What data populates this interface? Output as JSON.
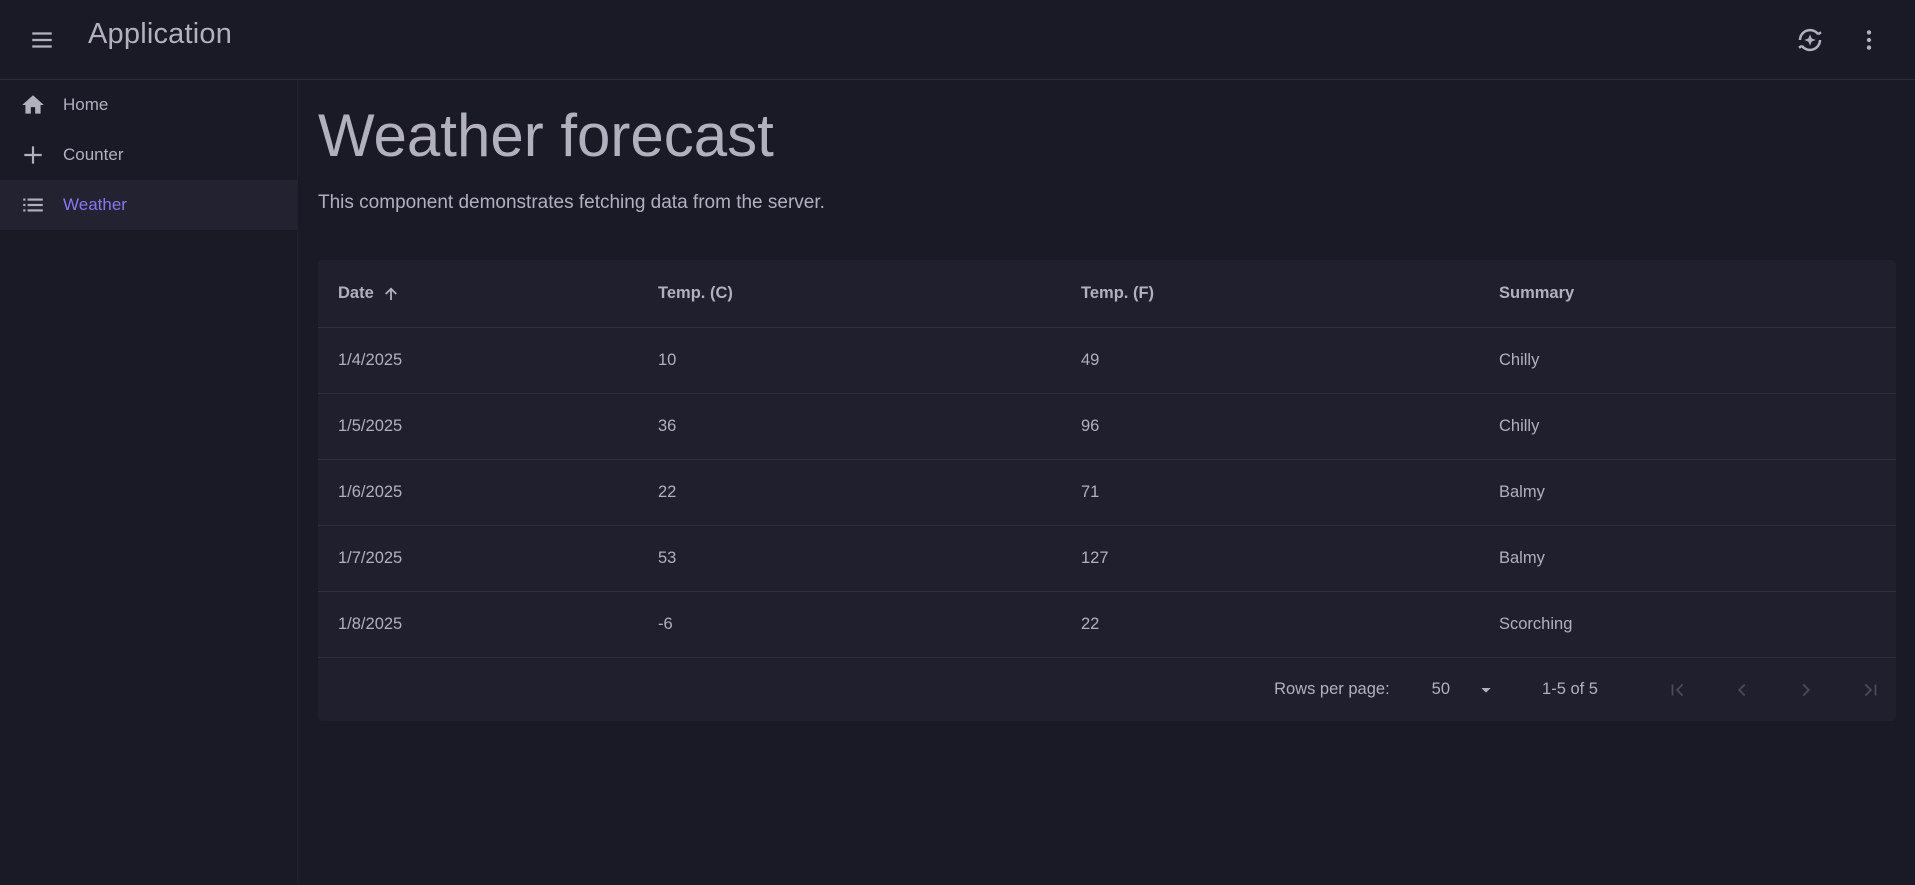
{
  "appbar": {
    "title": "Application",
    "menu_icon": "menu-icon",
    "theme_icon": "auto-mode-icon",
    "more_icon": "more-vert-icon"
  },
  "nav": {
    "items": [
      {
        "label": "Home",
        "icon": "home-icon",
        "active": false
      },
      {
        "label": "Counter",
        "icon": "plus-icon",
        "active": false
      },
      {
        "label": "Weather",
        "icon": "list-icon",
        "active": true
      }
    ]
  },
  "page": {
    "title": "Weather forecast",
    "description": "This component demonstrates fetching data from the server."
  },
  "table": {
    "columns": [
      "Date",
      "Temp. (C)",
      "Temp. (F)",
      "Summary"
    ],
    "sort": {
      "column": "Date",
      "direction": "ascending",
      "icon": "arrow-up-icon"
    },
    "rows": [
      [
        "1/4/2025",
        "10",
        "49",
        "Chilly"
      ],
      [
        "1/5/2025",
        "36",
        "96",
        "Chilly"
      ],
      [
        "1/6/2025",
        "22",
        "71",
        "Balmy"
      ],
      [
        "1/7/2025",
        "53",
        "127",
        "Balmy"
      ],
      [
        "1/8/2025",
        "-6",
        "22",
        "Scorching"
      ]
    ]
  },
  "pager": {
    "rows_per_page_label": "Rows per page:",
    "rows_per_page_value": "50",
    "range_text": "1-5 of 5"
  },
  "colors": {
    "background": "#1a1a27",
    "surface": "#1f1f2d",
    "text": "#b2b0bf",
    "accent": "#8b75f0",
    "disabled": "#4a4a5c"
  }
}
